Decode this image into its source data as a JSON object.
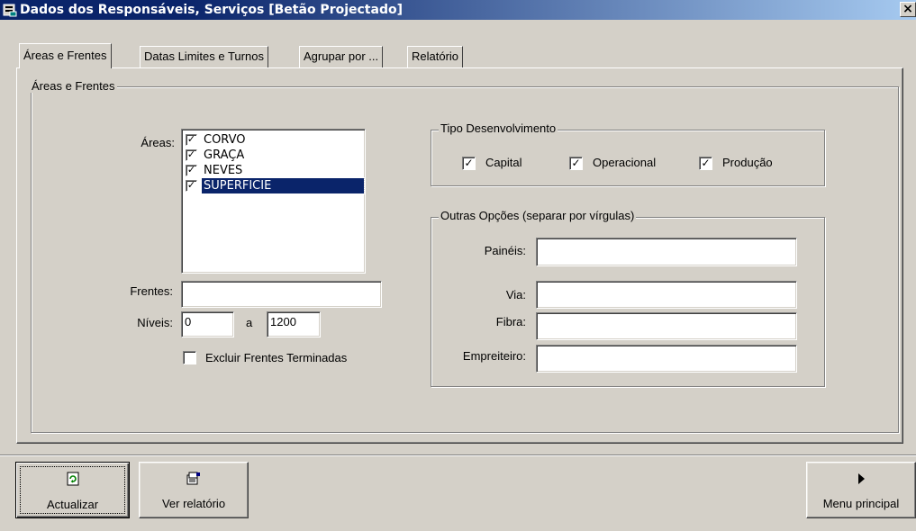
{
  "window": {
    "title": "Dados dos Responsáveis, Serviços [Betão Projectado]",
    "close_label": "×"
  },
  "tabs": [
    {
      "label": "Áreas e Frentes",
      "active": true
    },
    {
      "label": "Datas Limites e Turnos",
      "active": false
    },
    {
      "label": "Agrupar por ...",
      "active": false
    },
    {
      "label": "Relatório",
      "active": false
    }
  ],
  "areas_frentes_group": {
    "legend": "Áreas e Frentes",
    "areas_label": "Áreas:",
    "areas": [
      {
        "label": "CORVO",
        "checked": true,
        "selected": false
      },
      {
        "label": "GRAÇA",
        "checked": true,
        "selected": false
      },
      {
        "label": "NEVES",
        "checked": true,
        "selected": false
      },
      {
        "label": "SUPERFICIE",
        "checked": true,
        "selected": true
      }
    ],
    "frentes_label": "Frentes:",
    "frentes_value": "",
    "niveis_label": "Níveis:",
    "niveis_from": "0",
    "niveis_sep": "a",
    "niveis_to": "1200",
    "excluir_label": "Excluir Frentes Terminadas",
    "excluir_checked": false
  },
  "tipo_group": {
    "legend": "Tipo Desenvolvimento",
    "options": [
      {
        "label": "Capital",
        "checked": true
      },
      {
        "label": "Operacional",
        "checked": true
      },
      {
        "label": "Produção",
        "checked": true
      }
    ]
  },
  "outras_group": {
    "legend": "Outras Opções (separar por vírgulas)",
    "fields": [
      {
        "label": "Painéis:",
        "value": ""
      },
      {
        "label": "Via:",
        "value": ""
      },
      {
        "label": "Fibra:",
        "value": ""
      },
      {
        "label": "Empreiteiro:",
        "value": ""
      }
    ]
  },
  "buttons": {
    "actualizar": {
      "label": "Actualizar",
      "icon": "refresh-icon"
    },
    "ver_relatorio": {
      "label": "Ver relatório",
      "icon": "report-icon"
    },
    "menu_principal": {
      "label": "Menu principal",
      "icon": "play-arrow-icon"
    }
  },
  "colors": {
    "title_bar": "#0a246a",
    "selection": "#0a246a",
    "face": "#d4d0c8"
  }
}
